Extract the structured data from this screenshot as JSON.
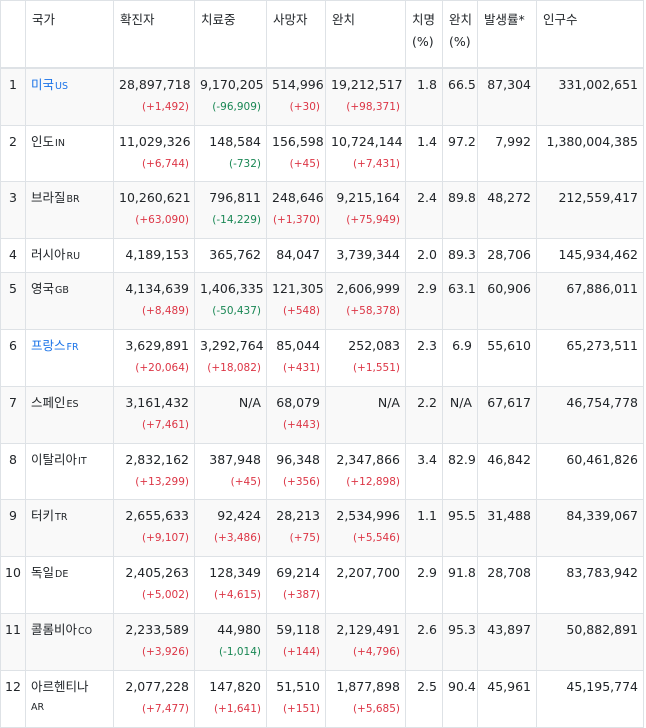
{
  "headers": {
    "country": "국가",
    "confirmed": "확진자",
    "treating": "치료중",
    "deaths": "사망자",
    "recovered": "완치",
    "fatality_l1": "치명",
    "fatality_l2": "(%)",
    "recovery_l1": "완치",
    "recovery_l2": "(%)",
    "incidence": "발생률*",
    "population": "인구수"
  },
  "rows": [
    {
      "rank": "1",
      "name": "미국",
      "code": "US",
      "link": true,
      "confirmed": "28,897,718",
      "confirmed_d": "(+1,492)",
      "treating": "9,170,205",
      "treating_d": "(-96,909)",
      "deaths": "514,996",
      "deaths_d": "(+30)",
      "recovered": "19,212,517",
      "recovered_d": "(+98,371)",
      "fatality": "1.8",
      "recovery": "66.5",
      "incidence": "87,304",
      "population": "331,002,651"
    },
    {
      "rank": "2",
      "name": "인도",
      "code": "IN",
      "link": false,
      "confirmed": "11,029,326",
      "confirmed_d": "(+6,744)",
      "treating": "148,584",
      "treating_d": "(-732)",
      "deaths": "156,598",
      "deaths_d": "(+45)",
      "recovered": "10,724,144",
      "recovered_d": "(+7,431)",
      "fatality": "1.4",
      "recovery": "97.2",
      "incidence": "7,992",
      "population": "1,380,004,385"
    },
    {
      "rank": "3",
      "name": "브라질",
      "code": "BR",
      "link": false,
      "confirmed": "10,260,621",
      "confirmed_d": "(+63,090)",
      "treating": "796,811",
      "treating_d": "(-14,229)",
      "deaths": "248,646",
      "deaths_d": "(+1,370)",
      "recovered": "9,215,164",
      "recovered_d": "(+75,949)",
      "fatality": "2.4",
      "recovery": "89.8",
      "incidence": "48,272",
      "population": "212,559,417"
    },
    {
      "rank": "4",
      "name": "러시아",
      "code": "RU",
      "link": false,
      "confirmed": "4,189,153",
      "confirmed_d": "",
      "treating": "365,762",
      "treating_d": "",
      "deaths": "84,047",
      "deaths_d": "",
      "recovered": "3,739,344",
      "recovered_d": "",
      "fatality": "2.0",
      "recovery": "89.3",
      "incidence": "28,706",
      "population": "145,934,462"
    },
    {
      "rank": "5",
      "name": "영국",
      "code": "GB",
      "link": false,
      "confirmed": "4,134,639",
      "confirmed_d": "(+8,489)",
      "treating": "1,406,335",
      "treating_d": "(-50,437)",
      "deaths": "121,305",
      "deaths_d": "(+548)",
      "recovered": "2,606,999",
      "recovered_d": "(+58,378)",
      "fatality": "2.9",
      "recovery": "63.1",
      "incidence": "60,906",
      "population": "67,886,011"
    },
    {
      "rank": "6",
      "name": "프랑스",
      "code": "FR",
      "link": true,
      "confirmed": "3,629,891",
      "confirmed_d": "(+20,064)",
      "treating": "3,292,764",
      "treating_d": "(+18,082)",
      "deaths": "85,044",
      "deaths_d": "(+431)",
      "recovered": "252,083",
      "recovered_d": "(+1,551)",
      "fatality": "2.3",
      "recovery": "6.9",
      "incidence": "55,610",
      "population": "65,273,511"
    },
    {
      "rank": "7",
      "name": "스페인",
      "code": "ES",
      "link": false,
      "confirmed": "3,161,432",
      "confirmed_d": "(+7,461)",
      "treating": "N/A",
      "treating_d": "",
      "deaths": "68,079",
      "deaths_d": "(+443)",
      "recovered": "N/A",
      "recovered_d": "",
      "fatality": "2.2",
      "recovery": "N/A",
      "incidence": "67,617",
      "population": "46,754,778"
    },
    {
      "rank": "8",
      "name": "이탈리아",
      "code": "IT",
      "link": false,
      "confirmed": "2,832,162",
      "confirmed_d": "(+13,299)",
      "treating": "387,948",
      "treating_d": "(+45)",
      "deaths": "96,348",
      "deaths_d": "(+356)",
      "recovered": "2,347,866",
      "recovered_d": "(+12,898)",
      "fatality": "3.4",
      "recovery": "82.9",
      "incidence": "46,842",
      "population": "60,461,826"
    },
    {
      "rank": "9",
      "name": "터키",
      "code": "TR",
      "link": false,
      "confirmed": "2,655,633",
      "confirmed_d": "(+9,107)",
      "treating": "92,424",
      "treating_d": "(+3,486)",
      "deaths": "28,213",
      "deaths_d": "(+75)",
      "recovered": "2,534,996",
      "recovered_d": "(+5,546)",
      "fatality": "1.1",
      "recovery": "95.5",
      "incidence": "31,488",
      "population": "84,339,067"
    },
    {
      "rank": "10",
      "name": "독일",
      "code": "DE",
      "link": false,
      "confirmed": "2,405,263",
      "confirmed_d": "(+5,002)",
      "treating": "128,349",
      "treating_d": "(+4,615)",
      "deaths": "69,214",
      "deaths_d": "(+387)",
      "recovered": "2,207,700",
      "recovered_d": "",
      "fatality": "2.9",
      "recovery": "91.8",
      "incidence": "28,708",
      "population": "83,783,942"
    },
    {
      "rank": "11",
      "name": "콜롬비아",
      "code": "CO",
      "link": false,
      "confirmed": "2,233,589",
      "confirmed_d": "(+3,926)",
      "treating": "44,980",
      "treating_d": "(-1,014)",
      "deaths": "59,118",
      "deaths_d": "(+144)",
      "recovered": "2,129,491",
      "recovered_d": "(+4,796)",
      "fatality": "2.6",
      "recovery": "95.3",
      "incidence": "43,897",
      "population": "50,882,891"
    },
    {
      "rank": "12",
      "name": "아르헨티나",
      "code": "AR",
      "link": false,
      "confirmed": "2,077,228",
      "confirmed_d": "(+7,477)",
      "treating": "147,820",
      "treating_d": "(+1,641)",
      "deaths": "51,510",
      "deaths_d": "(+151)",
      "recovered": "1,877,898",
      "recovered_d": "(+5,685)",
      "fatality": "2.5",
      "recovery": "90.4",
      "incidence": "45,961",
      "population": "45,195,774"
    }
  ]
}
